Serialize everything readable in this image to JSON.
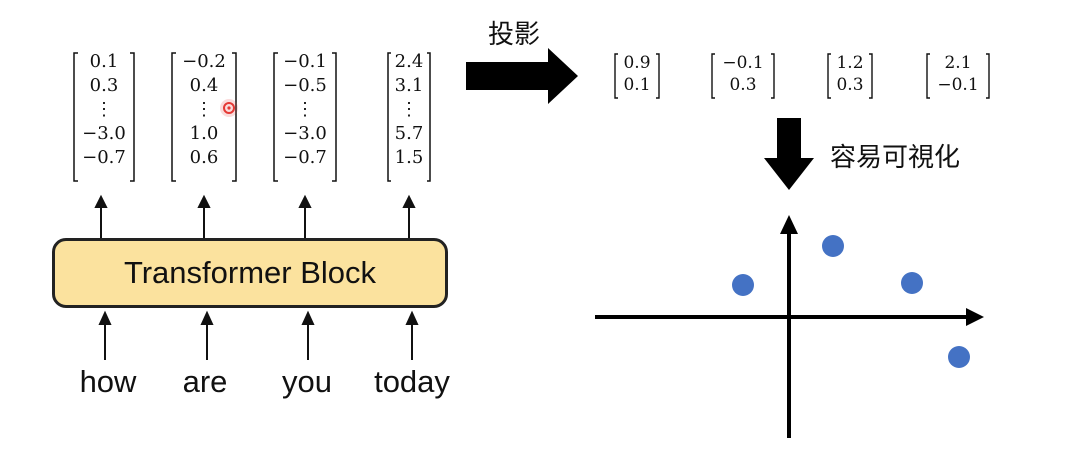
{
  "transformer": {
    "label": "Transformer Block"
  },
  "tokens": [
    "how",
    "are",
    "you",
    "today"
  ],
  "embeddings": [
    [
      "0.1",
      "0.3",
      "⋮",
      "−3.0",
      "−0.7"
    ],
    [
      "−0.2",
      "0.4",
      "⋮",
      "1.0",
      "0.6"
    ],
    [
      "−0.1",
      "−0.5",
      "⋮",
      "−3.0",
      "−0.7"
    ],
    [
      "2.4",
      "3.1",
      "⋮",
      "5.7",
      "1.5"
    ]
  ],
  "projection_label": "投影",
  "projected": [
    [
      "0.9",
      "0.1"
    ],
    [
      "−0.1",
      "0.3"
    ],
    [
      "1.2",
      "0.3"
    ],
    [
      "2.1",
      "−0.1"
    ]
  ],
  "visualize_label": "容易可視化",
  "colors": {
    "block_fill": "#fbe29e",
    "point": "#4472c4",
    "cursor": "#e53935"
  }
}
